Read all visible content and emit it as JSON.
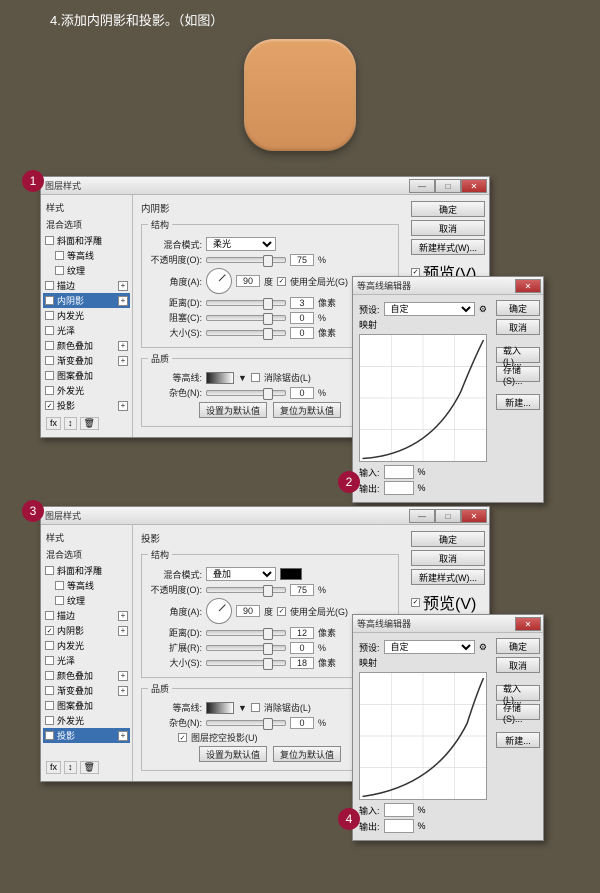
{
  "heading": "4.添加内阴影和投影。（如图）",
  "badges": [
    "1",
    "2",
    "3",
    "4"
  ],
  "dialog1": {
    "title": "图层样式",
    "styles_header": "样式",
    "blend_options": "混合选项",
    "items": [
      {
        "label": "斜面和浮雕",
        "checked": false
      },
      {
        "label": "等高线",
        "checked": false,
        "indent": true
      },
      {
        "label": "纹理",
        "checked": false,
        "indent": true
      },
      {
        "label": "描边",
        "checked": false,
        "plus": true
      },
      {
        "label": "内阴影",
        "checked": true,
        "selected": true,
        "plus": true
      },
      {
        "label": "内发光",
        "checked": false
      },
      {
        "label": "光泽",
        "checked": false
      },
      {
        "label": "颜色叠加",
        "checked": false,
        "plus": true
      },
      {
        "label": "渐变叠加",
        "checked": false,
        "plus": true
      },
      {
        "label": "图案叠加",
        "checked": false
      },
      {
        "label": "外发光",
        "checked": false
      },
      {
        "label": "投影",
        "checked": true,
        "plus": true
      }
    ],
    "panel_title": "内阴影",
    "group_struct": "结构",
    "blend_mode": "混合模式:",
    "blend_val": "柔光",
    "opacity": "不透明度(O):",
    "opacity_val": "75",
    "pct": "%",
    "angle": "角度(A):",
    "angle_val": "90",
    "deg": "度",
    "global": "使用全局光(G)",
    "distance": "距离(D):",
    "distance_val": "3",
    "px": "像素",
    "choke": "阻塞(C):",
    "choke_val": "0",
    "size": "大小(S):",
    "size_val": "0",
    "group_quality": "品质",
    "contour": "等高线:",
    "anti": "消除锯齿(L)",
    "noise": "杂色(N):",
    "noise_val": "0",
    "btn_default": "设置为默认值",
    "btn_reset": "复位为默认值",
    "ok": "确定",
    "cancel": "取消",
    "newstyle": "新建样式(W)...",
    "preview": "预览(V)"
  },
  "dialog2": {
    "panel_title": "投影",
    "blend_val": "叠加",
    "distance_val": "12",
    "spread": "扩展(R):",
    "spread_val": "0",
    "size_val": "18",
    "knockout": "图层挖空投影(U)",
    "items": [
      {
        "label": "斜面和浮雕",
        "checked": false
      },
      {
        "label": "等高线",
        "checked": false,
        "indent": true
      },
      {
        "label": "纹理",
        "checked": false,
        "indent": true
      },
      {
        "label": "描边",
        "checked": false,
        "plus": true
      },
      {
        "label": "内阴影",
        "checked": true,
        "plus": true
      },
      {
        "label": "内发光",
        "checked": false
      },
      {
        "label": "光泽",
        "checked": false
      },
      {
        "label": "颜色叠加",
        "checked": false,
        "plus": true
      },
      {
        "label": "渐变叠加",
        "checked": false,
        "plus": true
      },
      {
        "label": "图案叠加",
        "checked": false
      },
      {
        "label": "外发光",
        "checked": false
      },
      {
        "label": "投影",
        "checked": true,
        "selected": true,
        "plus": true
      }
    ]
  },
  "contour_editor": {
    "title": "等高线编辑器",
    "preset": "预设:",
    "preset_val": "自定",
    "mapping": "映射",
    "input": "输入:",
    "output": "输出:",
    "pct": "%",
    "ok": "确定",
    "cancel": "取消",
    "load": "载入(L)...",
    "save": "存储(S)...",
    "new": "新建..."
  },
  "footer_fx": "fx",
  "win": {
    "min": "—",
    "max": "□",
    "close": "✕"
  }
}
